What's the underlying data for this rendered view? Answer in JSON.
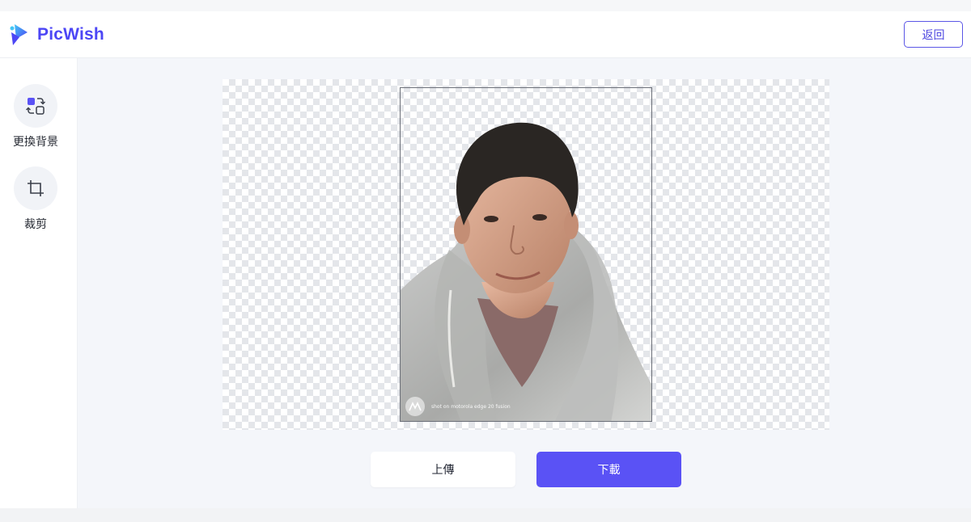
{
  "app": {
    "brand_name": "PicWish",
    "accent_color": "#5a52f5"
  },
  "header": {
    "back_label": "返回"
  },
  "sidebar": {
    "items": [
      {
        "label": "更換背景",
        "icon": "swap-background-icon"
      },
      {
        "label": "裁剪",
        "icon": "crop-icon"
      }
    ]
  },
  "canvas": {
    "image_subject": "person-cutout",
    "watermark_text": "shot on motorola edge 20 fusion"
  },
  "actions": {
    "upload_label": "上傳",
    "download_label": "下載"
  }
}
